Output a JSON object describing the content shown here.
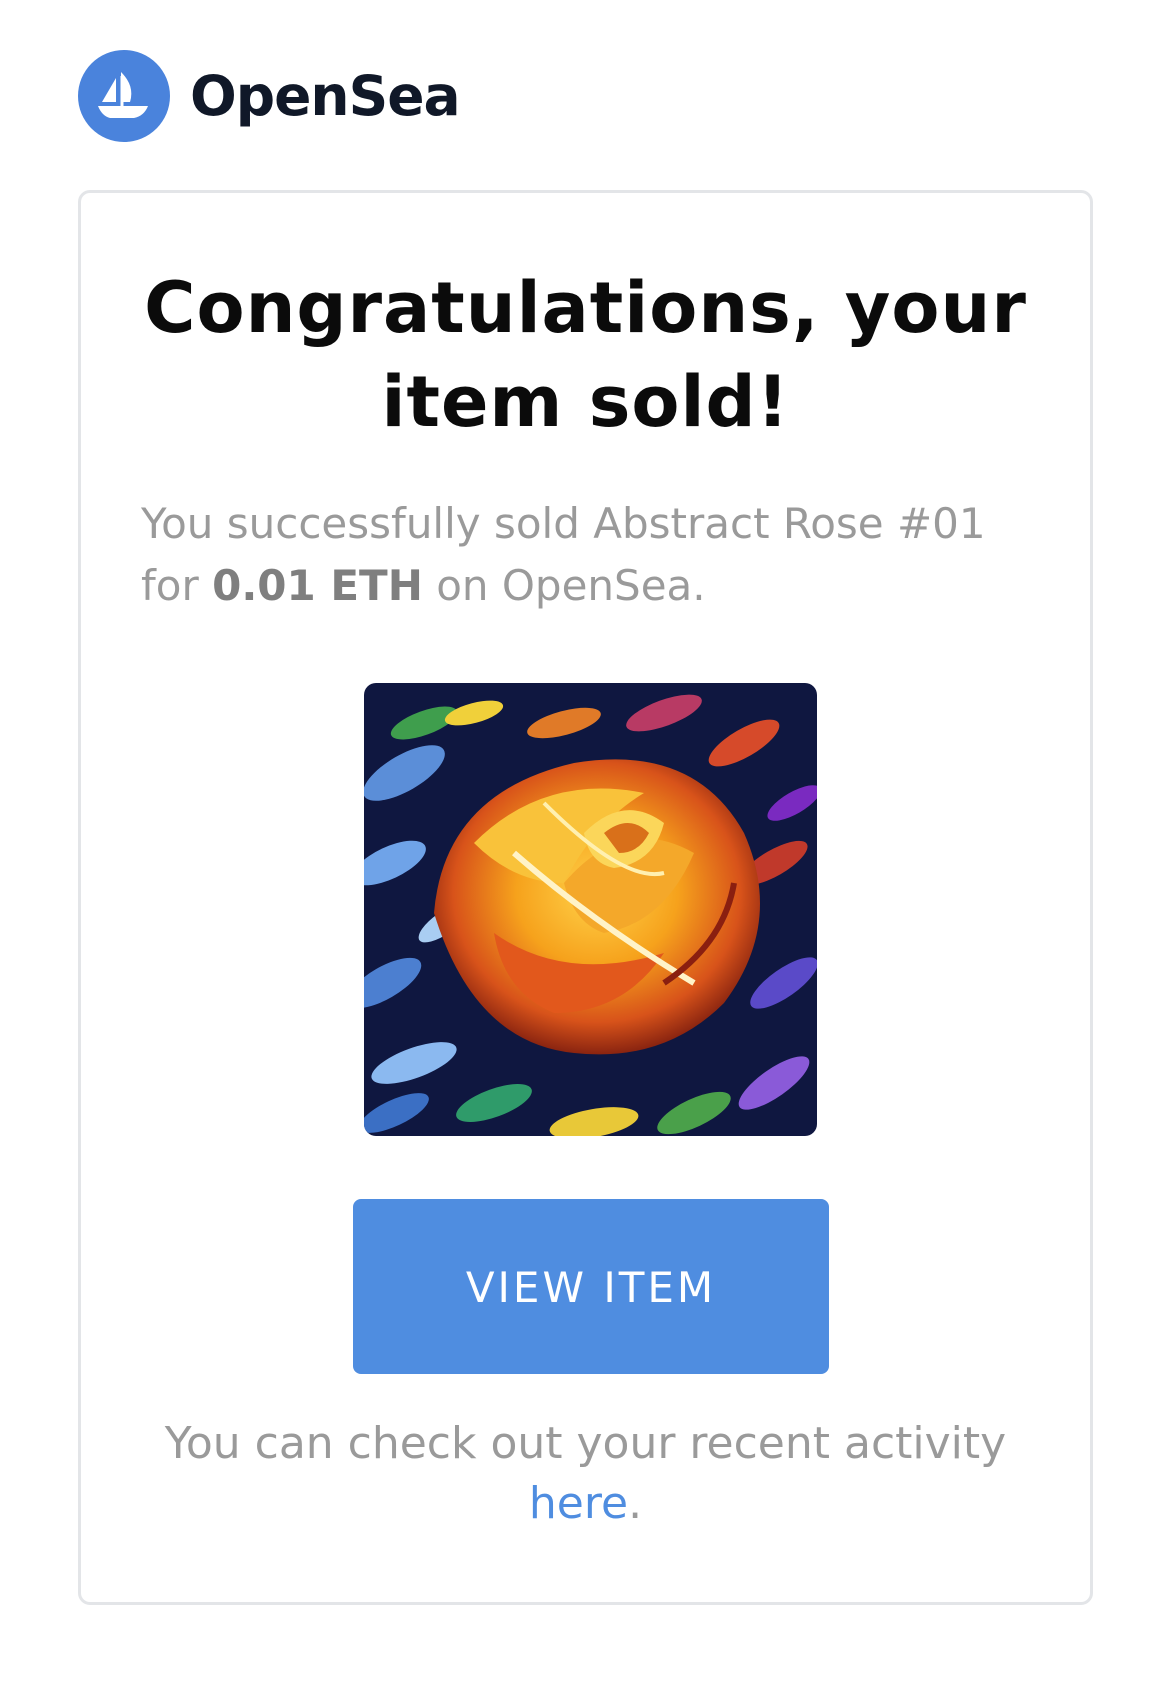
{
  "header": {
    "brand_name": "OpenSea",
    "logo_icon": "sailboat-icon",
    "brand_color": "#4a83dc"
  },
  "card": {
    "title_line1": "Congratulations, your",
    "title_line2": "item sold!",
    "message_prefix": "You successfully sold Abstract Rose #01 for ",
    "message_amount": "0.01 ETH",
    "message_suffix": " on OpenSea.",
    "item_image": "abstract-rose-painting",
    "view_button_label": "VIEW ITEM",
    "button_color": "#4f8de0",
    "footer_text": "You can check out your recent activity",
    "footer_link_label": "here",
    "footer_period": "."
  }
}
